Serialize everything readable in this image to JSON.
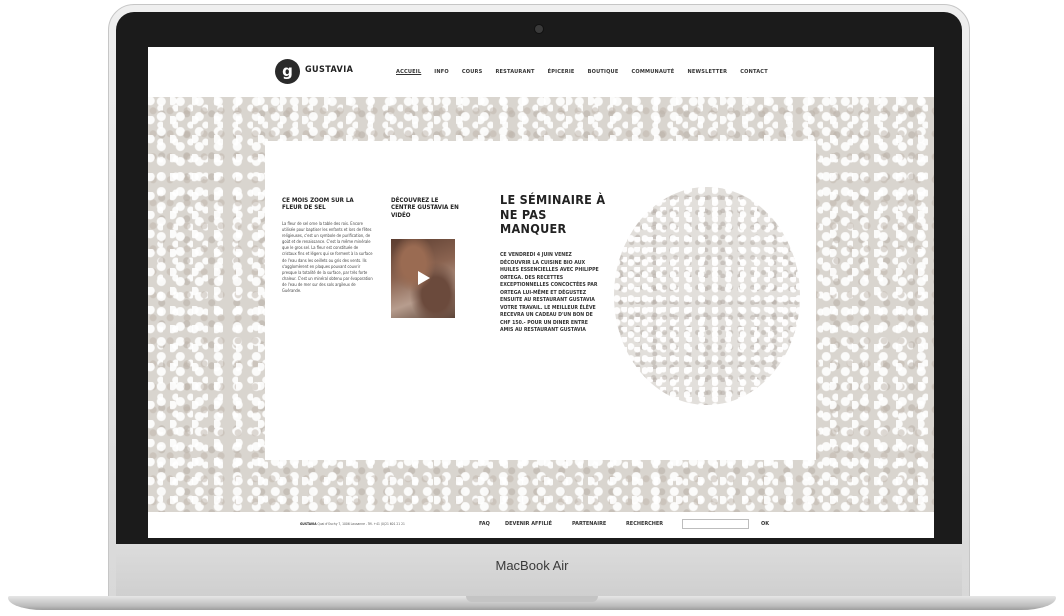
{
  "device": {
    "label": "MacBook Air"
  },
  "site": {
    "logo_letter": "g",
    "name": "GUSTAVIA"
  },
  "nav": {
    "items": [
      {
        "label": "ACCUEIL",
        "active": true
      },
      {
        "label": "INFO"
      },
      {
        "label": "COURS"
      },
      {
        "label": "RESTAURANT"
      },
      {
        "label": "ÉPICERIE"
      },
      {
        "label": "BOUTIQUE"
      },
      {
        "label": "COMMUNAUTÉ"
      },
      {
        "label": "NEWSLETTER"
      },
      {
        "label": "CONTACT"
      }
    ]
  },
  "zoom": {
    "heading": "CE MOIS ZOOM SUR LA FLEUR DE SEL",
    "body": "La fleur de sel orne la table des rois. Encore utilisée pour baptiser les enfants et lors de fêtes religieuses, c'est un symbole de purification, de goût et de renaissance. C'est la même minérale que le gros sel. La fleur est constituée de cristaux fins et légers qui se forment à la surface de l'eau dans les oeillets ou gris des vents. Ils s'agglomèrent en plaques pouvant couvrir presque la totalité de la surface, par très forte chaleur. C'est un minéral obtenu par évaporation de l'eau de mer sur des sols argileux de Guérande."
  },
  "video": {
    "heading": "DÉCOUVREZ LE CENTRE GUSTAVIA EN VIDÉO"
  },
  "seminar": {
    "title": "LE SÉMINAIRE À NE PAS MANQUER",
    "body": "CE VENDREDI 4 JUIN VENEZ DÉCOUVRIR LA CUISINE BIO AUX HUILES ESSENCIELLES AVEC PHILIPPE ORTEGA. DES RECETTES EXCEPTIONNELLES CONCOCTÉES PAR ORTEGA LUI-MÊME ET DÉGUSTEZ ENSUITE AU RESTAURANT GUSTAVIA VOTRE TRAVAIL. LE MEILLEUR ÉLÈVE RECEVRA UN CADEAU D'UN BON DE CHF 150.- POUR UN DINER ENTRE AMIS AU RESTAURANT GUSTAVIA"
  },
  "footer": {
    "address_name": "GUSTAVIA",
    "address_rest": "Quai d'Ouchy 7, 1006 Lausanne - Tél. +41 (0)21 601 21 21",
    "links": {
      "faq": "FAQ",
      "affiliate": "DEVENIR AFFILIÉ",
      "partner": "PARTENAIRE",
      "search": "RECHERCHER",
      "ok": "OK"
    }
  },
  "colors": {
    "screen_bezel": "#1b1b1b",
    "text_dark": "#222222",
    "salt_bg": "#d9d5cf"
  }
}
